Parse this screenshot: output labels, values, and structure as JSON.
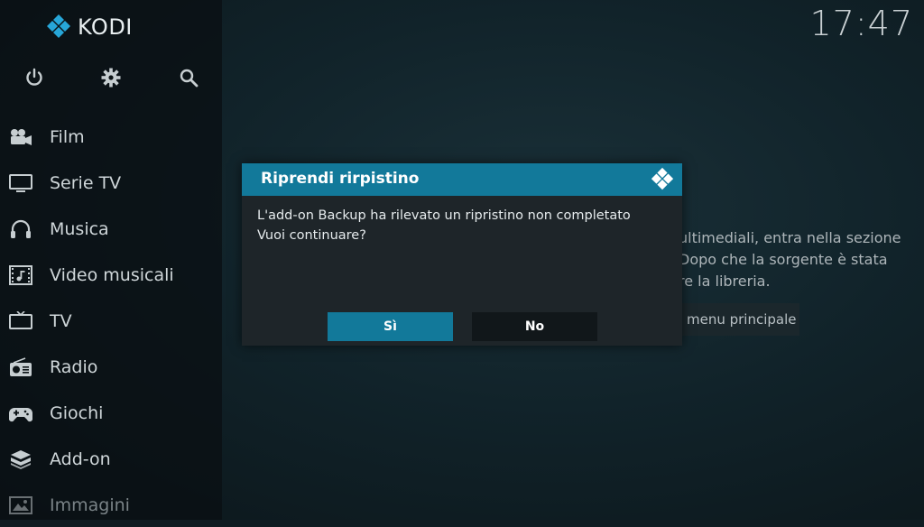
{
  "app": {
    "name": "KODI",
    "clock": "17:47"
  },
  "top_icons": [
    "power-icon",
    "gear-icon",
    "search-icon"
  ],
  "sidebar": {
    "items": [
      {
        "label": "Film",
        "icon": "film-icon"
      },
      {
        "label": "Serie TV",
        "icon": "tv-series-icon"
      },
      {
        "label": "Musica",
        "icon": "headphones-icon"
      },
      {
        "label": "Video musicali",
        "icon": "music-video-icon"
      },
      {
        "label": "TV",
        "icon": "tv-icon"
      },
      {
        "label": "Radio",
        "icon": "radio-icon"
      },
      {
        "label": "Giochi",
        "icon": "gamepad-icon"
      },
      {
        "label": "Add-on",
        "icon": "addon-box-icon"
      },
      {
        "label": "Immagini",
        "icon": "picture-icon"
      }
    ]
  },
  "background": {
    "lines": [
      "ultimediali, entra nella sezione",
      "Dopo che la sorgente è stata",
      "re la libreria."
    ],
    "button_label": "menu principale"
  },
  "dialog": {
    "title": "Riprendi rirpistino",
    "message_line1": "L'add-on Backup ha rilevato un ripristino non completato",
    "message_line2": "Vuoi continuare?",
    "yes_label": "Sì",
    "no_label": "No"
  },
  "colors": {
    "accent": "#12799a",
    "dialog_bg": "#1e2529",
    "sidebar_bg": "#0a1013"
  }
}
